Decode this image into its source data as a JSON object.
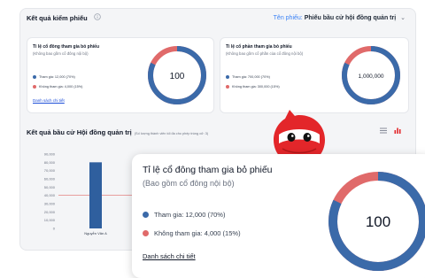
{
  "header": {
    "title": "Kết quả kiểm phiếu",
    "ballot_label": "Tên phiếu:",
    "ballot_value": "Phiếu bầu cử hội đồng quản trị"
  },
  "cards": [
    {
      "title": "Tỉ lệ cổ đông tham gia bỏ phiếu",
      "subtitle": "(Không bao gồm cổ đông nội bộ)",
      "participated": "Tham gia: 12,000 (70%)",
      "not_participated": "Không tham gia: 4,000 (15%)",
      "link": "Danh sách chi tiết",
      "donut_value": "100",
      "ratio": 0.82
    },
    {
      "title": "Tỉ lệ cổ phần tham gia bỏ phiếu",
      "subtitle": "(Không bao gồm cổ phần của cổ đông nội bộ)",
      "participated": "Tham gia: 700,000 (70%)",
      "not_participated": "Không tham gia: 300,000 (15%)",
      "donut_value": "1,000,000",
      "ratio": 0.82
    }
  ],
  "results": {
    "title": "Kết quả bầu cử Hội đồng quản trị",
    "note": "(Số lượng thành viên tối đa cho phép trúng cử: 3)"
  },
  "chart_data": {
    "type": "bar",
    "categories": [
      "Nguyễn Văn A"
    ],
    "values": [
      80000
    ],
    "threshold": 40000,
    "ylim": [
      0,
      90000
    ],
    "yticks": [
      "0",
      "10,000",
      "20,000",
      "30,000",
      "40,000",
      "50,000",
      "60,000",
      "70,000",
      "80,000",
      "90,000"
    ]
  },
  "popup": {
    "title": "Tỉ lệ cổ đông tham gia bỏ phiếu",
    "subtitle": "(Bao gồm cổ đông nội bộ)",
    "participated": "Tham gia: 12,000 (70%)",
    "not_participated": "Không tham gia: 4,000 (15%)",
    "link": "Danh sách chi tiết",
    "donut_value": "100"
  },
  "colors": {
    "blue": "#3b6aa9",
    "red": "#e06a6a",
    "accent": "#3b82f6",
    "mascot": "#e3262a"
  },
  "icons": [
    "info-icon",
    "chevron-down-icon",
    "list-icon",
    "bar-chart-icon"
  ]
}
